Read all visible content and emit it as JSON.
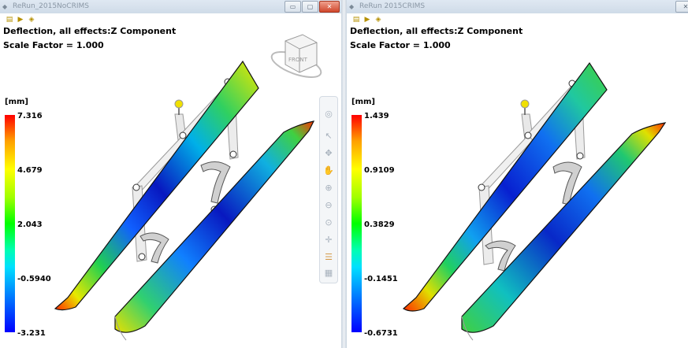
{
  "left_window": {
    "title": "ReRun_2015NoCRIMS",
    "result_title": "Deflection, all effects:Z Component",
    "scale_factor": "Scale Factor = 1.000",
    "unit": "[mm]",
    "legend": [
      "7.316",
      "4.679",
      "2.043",
      "-0.5940",
      "-3.231"
    ],
    "cube_label": "FRONT",
    "window_buttons": {
      "minimize": "▭",
      "maximize": "▢",
      "close": "✕"
    }
  },
  "right_window": {
    "title": "ReRun 2015CRIMS",
    "result_title": "Deflection, all effects:Z Component",
    "scale_factor": "Scale Factor = 1.000",
    "unit": "[mm]",
    "legend": [
      "1.439",
      "0.9109",
      "0.3829",
      "-0.1451",
      "-0.6731"
    ],
    "window_buttons": {
      "close": "✕"
    }
  },
  "toolbar_icons": [
    "result-icon",
    "play-icon",
    "animate-icon"
  ],
  "nav_bar_icons": [
    "steering-wheel-icon",
    "select-arrow-icon",
    "orbit-icon",
    "pan-hand-icon",
    "zoom-window-icon",
    "zoom-icon",
    "zoom-all-icon",
    "look-at-icon",
    "section-icon",
    "view-manager-icon"
  ],
  "colors": {
    "legend_top": "#ff0000",
    "legend_bottom": "#0000ff",
    "close_button": "#d0472c",
    "titlebar": "#dfe8f2"
  }
}
